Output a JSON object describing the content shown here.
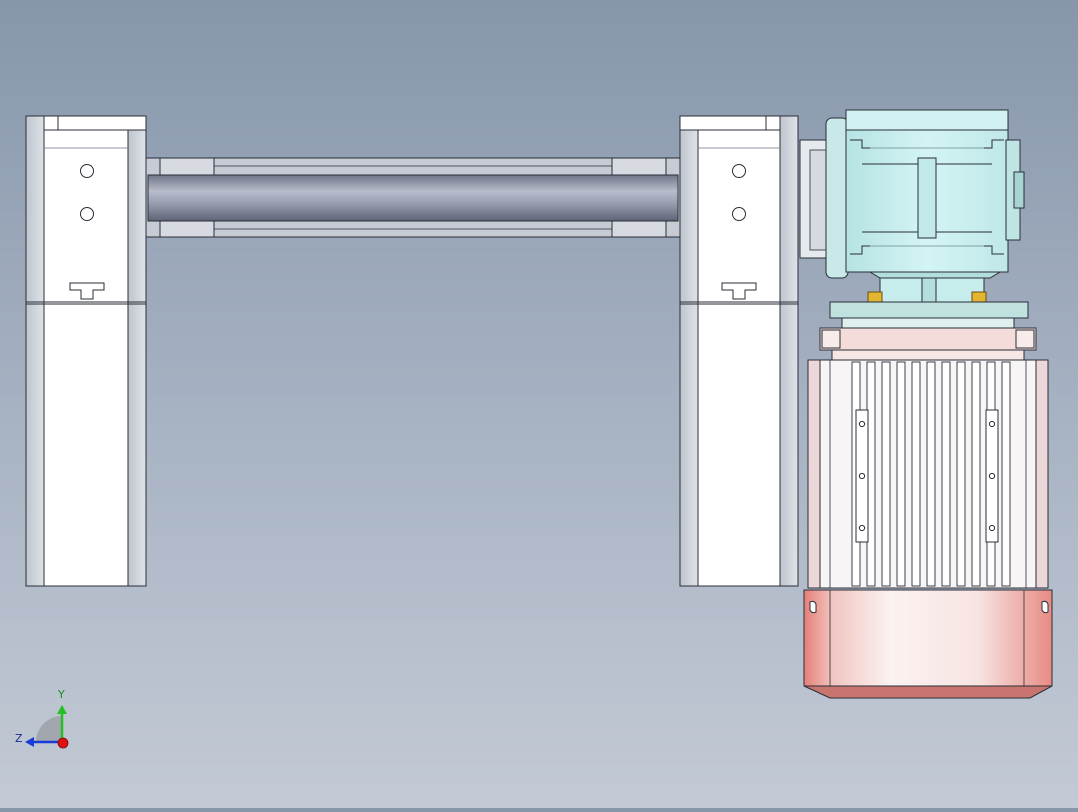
{
  "viewport": {
    "background_top": "#8796ab",
    "background_bottom": "#c3cad5"
  },
  "triad": {
    "y_label": "Y",
    "z_label": "Z",
    "y_color": "#22c022",
    "z_color": "#1a3cd8",
    "origin_color": "#e01010"
  },
  "colors": {
    "frame": "#ffffff",
    "frame_side": "#c9ced6",
    "tube": "#8d94a6",
    "gearbox": "#c6eeee",
    "motor_red": "#e98d86",
    "motor_body": "#f6f3f4",
    "bolt": "#e0b020"
  }
}
